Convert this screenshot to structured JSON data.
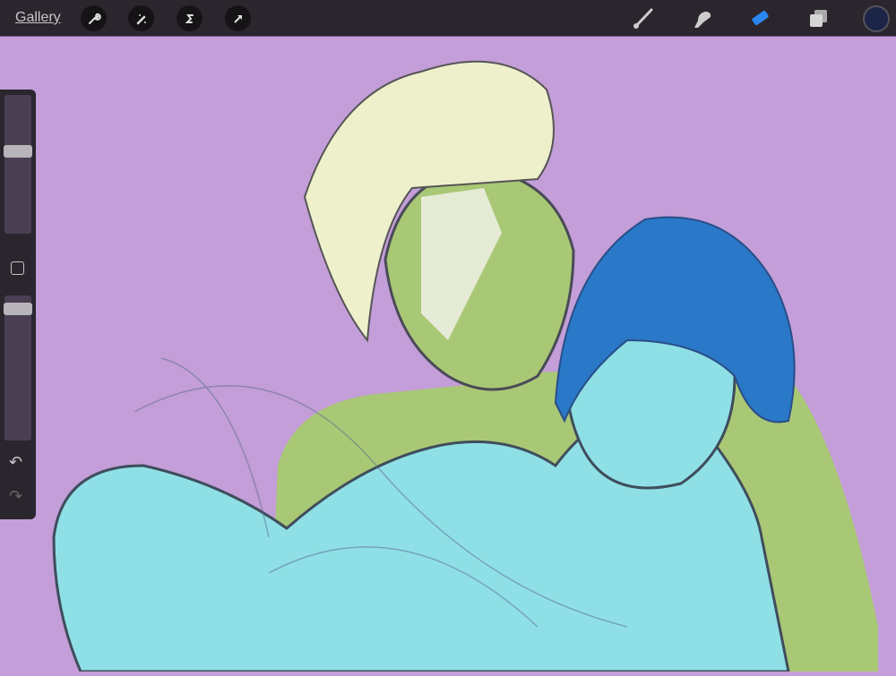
{
  "topbar": {
    "gallery_label": "Gallery",
    "left_tools": [
      "wrench-icon",
      "magic-wand-icon",
      "selection-icon",
      "transform-arrow-icon"
    ],
    "right_tools": [
      "brush-icon",
      "smudge-icon",
      "eraser-icon",
      "layers-icon"
    ],
    "active_tool": "eraser",
    "current_color": "#1c2447",
    "accent": "#2a86f0"
  },
  "sidebar": {
    "brush_size": 0.42,
    "opacity": 0.03,
    "undo": "↶",
    "redo": "↷"
  }
}
